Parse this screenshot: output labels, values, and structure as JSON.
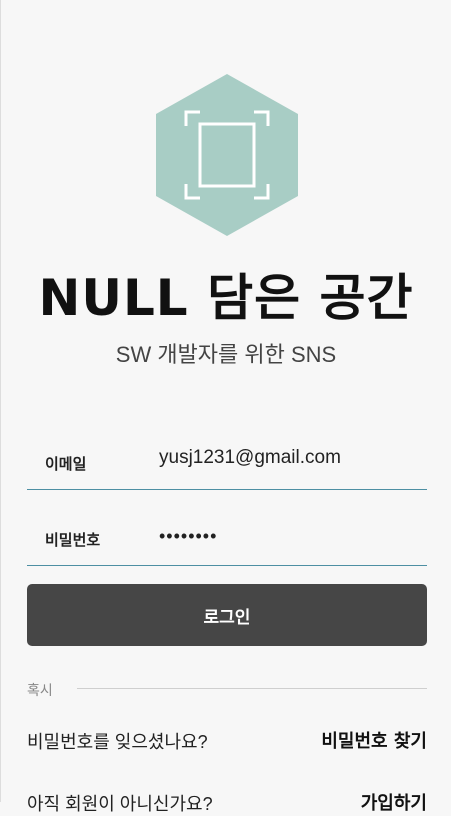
{
  "app": {
    "title": "NULL 담은 공간",
    "subtitle": "SW 개발자를 위한 SNS",
    "logo_icon": "hexagon-frame-icon",
    "logo_color": "#a8cdc5"
  },
  "form": {
    "email_label": "이메일",
    "email_value": "yusj1231@gmail.com",
    "password_label": "비밀번호",
    "password_value": "••••••••",
    "login_label": "로그인"
  },
  "help": {
    "divider_label": "혹시",
    "forgot_text": "비밀번호를 잊으셨나요?",
    "forgot_link": "비밀번호 찾기",
    "signup_text": "아직 회원이 아니신가요?",
    "signup_link": "가입하기"
  },
  "colors": {
    "background": "#f7f7f7",
    "button": "#464646",
    "underline": "#4d8fa3"
  }
}
